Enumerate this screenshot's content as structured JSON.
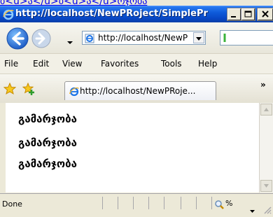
{
  "stray_text": "ბ<u>ა</u>ბ<u>ა</u>რჯობა",
  "window": {
    "title": "http://localhost/NewPRoject/SimplePr",
    "buttons": {
      "minimize": "minimize",
      "maximize": "maximize",
      "close": "close"
    }
  },
  "navbar": {
    "address": "http://localhost/NewP"
  },
  "menu": {
    "items": [
      "File",
      "Edit",
      "View",
      "Favorites",
      "Tools",
      "Help"
    ]
  },
  "tabbar": {
    "tab_label": "http://localhost/NewPRoje...",
    "chevron": "»"
  },
  "content": {
    "lines": [
      "გამარჯობა",
      "გამარჯობა",
      "გამარჯობა"
    ]
  },
  "status": {
    "text": "Done",
    "zoom": "%"
  },
  "colors": {
    "titlebar": "#0e5ad9",
    "chrome": "#ece9d8",
    "link": "#0000ee"
  }
}
